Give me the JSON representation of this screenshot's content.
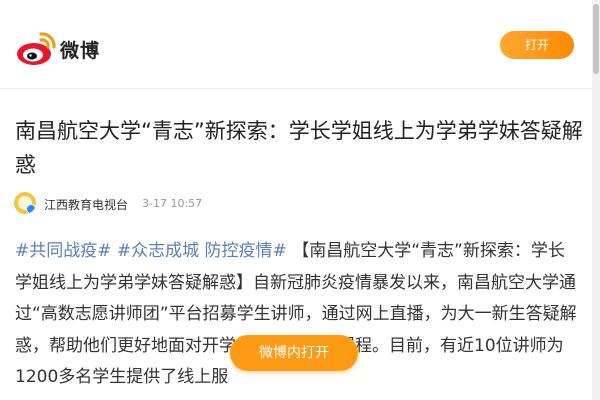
{
  "header": {
    "brand": "微博",
    "open_label": "打开"
  },
  "article": {
    "title": "南昌航空大学“青志”新探索：学长学姐线上为学弟学妹答疑解惑",
    "author": "江西教育电视台",
    "time": "3-17 10:57",
    "tags": [
      "#共同战疫#",
      "#众志成城 防控疫情#"
    ],
    "body_text": "【南昌航空大学“青志”新探索：学长学姐线上为学弟学妹答疑解惑】自新冠肺炎疫情暴发以来，南昌航空大学通过“高数志愿讲师团”平台招募学生讲师，通过网上直播，为大一新生答疑解惑，帮助他们更好地面对开学后的高等数学课程。目前，有近10位讲师为1200多名学生提供了线上服"
  },
  "floating": {
    "open_in_app_label": "微博内打开"
  },
  "colors": {
    "accent": "#ff8a00",
    "tag": "#5b7fb8",
    "weibo_red": "#e6162d"
  },
  "icons": {
    "logo": "weibo-logo-icon",
    "avatar": "author-avatar",
    "verified": "verified-badge-icon"
  }
}
